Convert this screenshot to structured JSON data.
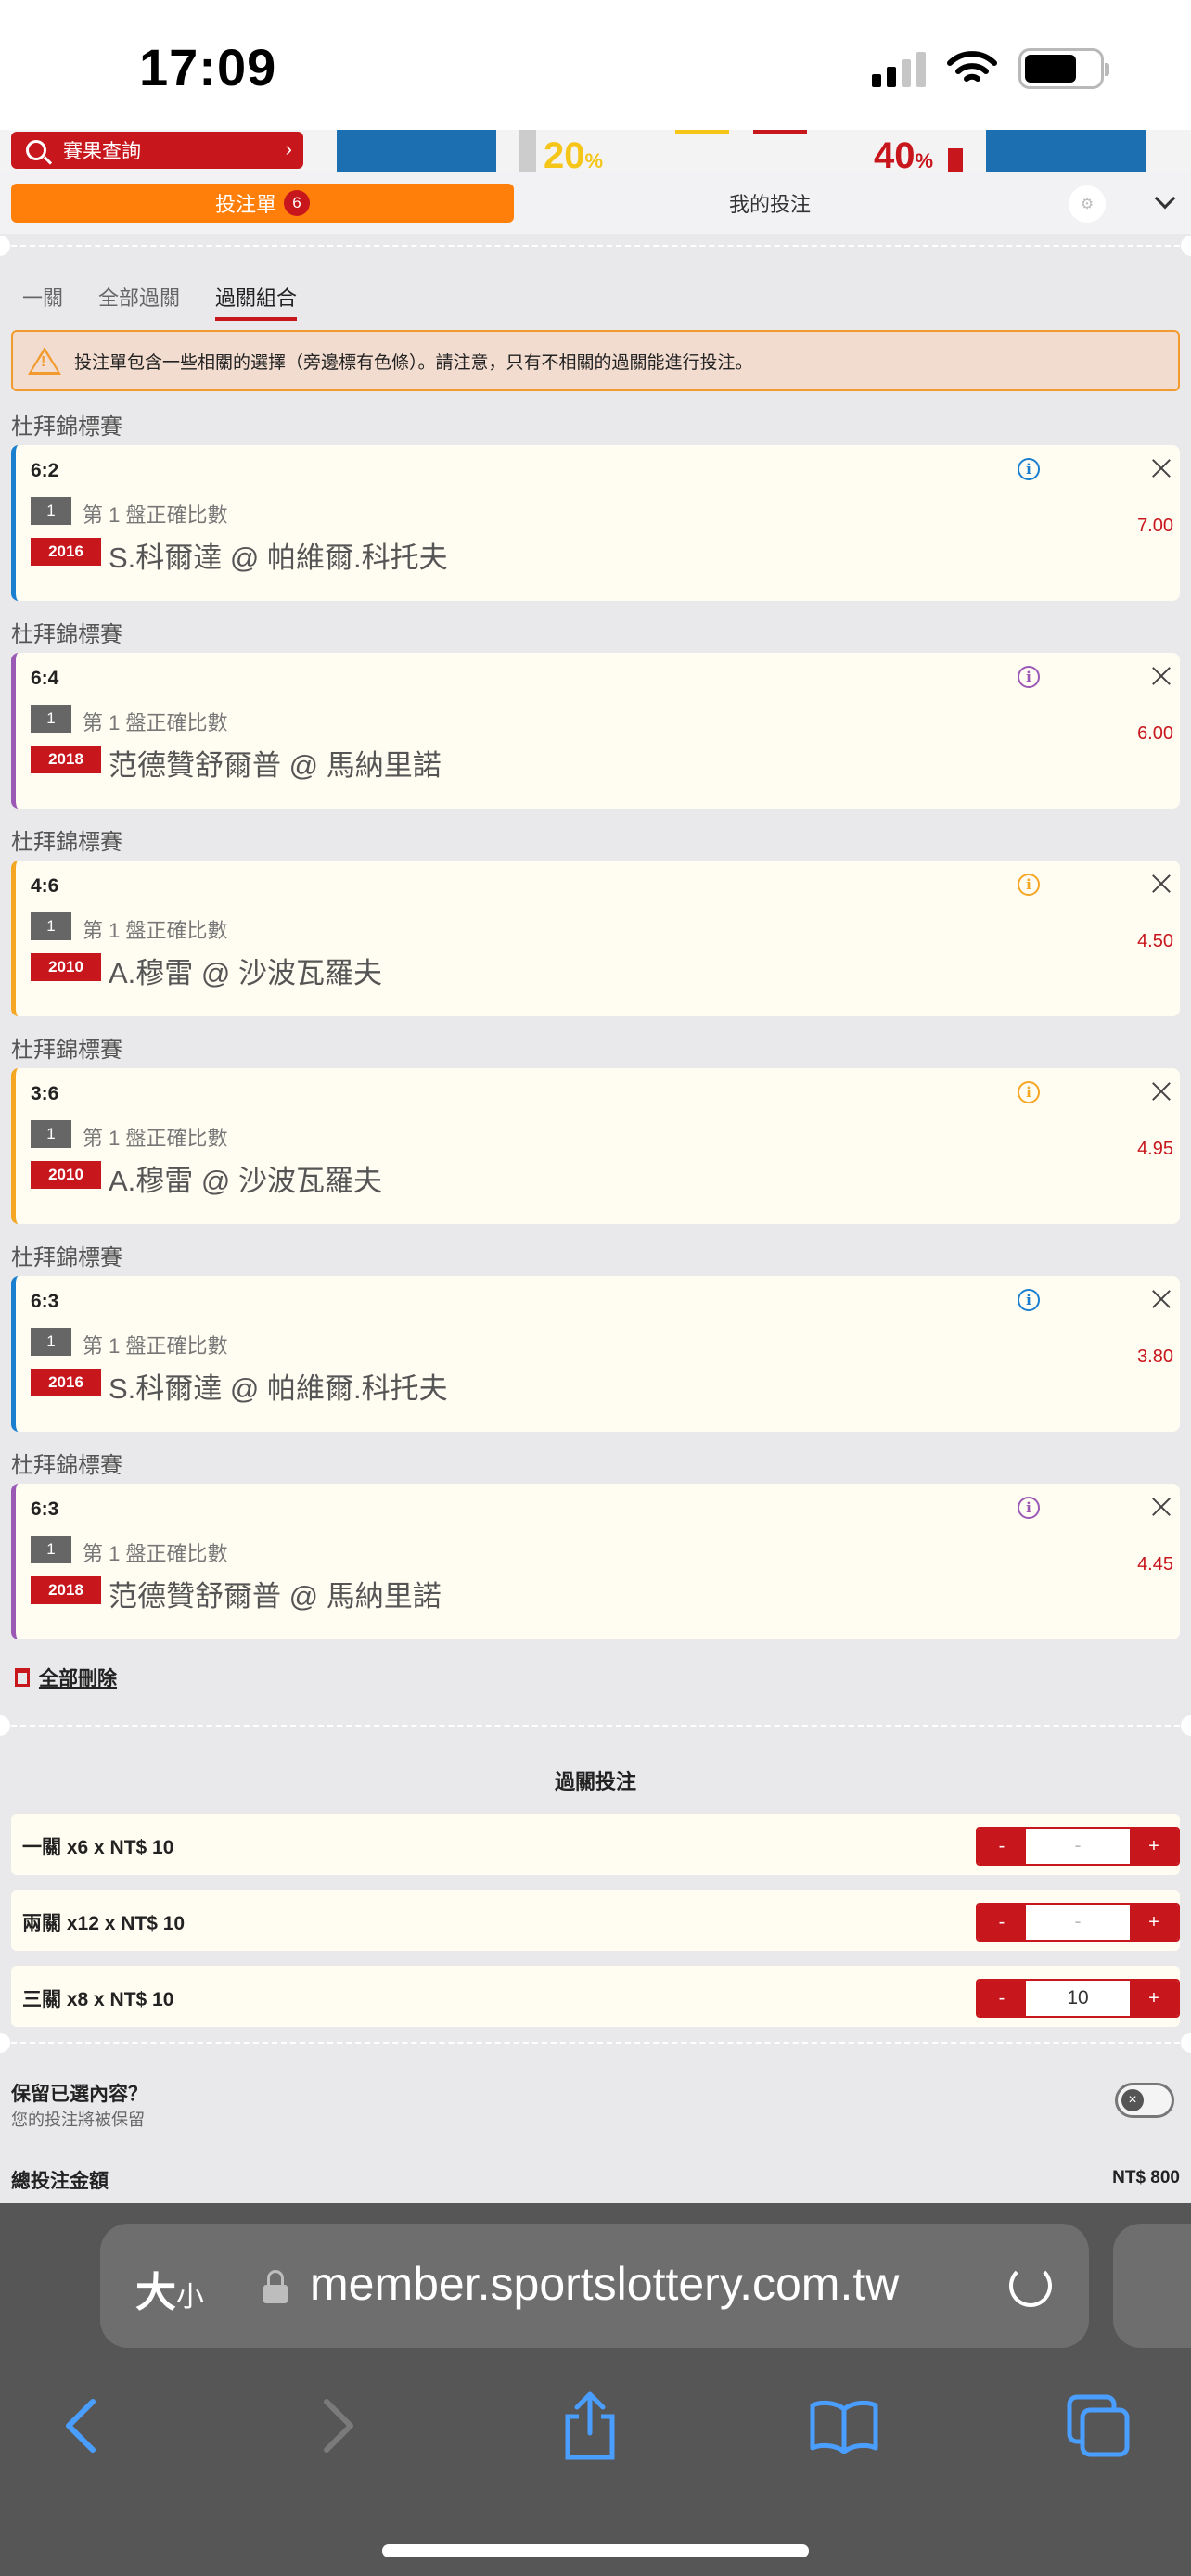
{
  "status_bar": {
    "time": "17:09"
  },
  "background": {
    "result_query_label": "賽果查詢",
    "pct_left": "20",
    "pct_right": "40",
    "pct_unit": "%"
  },
  "tabs": {
    "bet_slip_label": "投注單",
    "bet_slip_count": "6",
    "my_bets_label": "我的投注"
  },
  "subtabs": {
    "single": "一關",
    "all_parlay": "全部過關",
    "parlay_combo": "過關組合"
  },
  "warning_text": "投注單包含一些相關的選擇（旁邊標有色條）。請注意，只有不相關的過關能進行投注。",
  "accent_colors": {
    "red": "#c8161d",
    "orange": "#ff7f0a",
    "blue": "#1b7fcf",
    "purple": "#9b59b6",
    "amber": "#f5a623"
  },
  "selections": [
    {
      "league": "杜拜錦標賽",
      "score": "6:2",
      "set": "1",
      "market": "第 1 盤正確比數",
      "event_id": "2016",
      "teams": "S.科爾達 @ 帕維爾.科托夫",
      "odds": "7.00",
      "color": "#1b7fcf"
    },
    {
      "league": "杜拜錦標賽",
      "score": "6:4",
      "set": "1",
      "market": "第 1 盤正確比數",
      "event_id": "2018",
      "teams": "范德贊舒爾普 @ 馬納里諾",
      "odds": "6.00",
      "color": "#9b59b6"
    },
    {
      "league": "杜拜錦標賽",
      "score": "4:6",
      "set": "1",
      "market": "第 1 盤正確比數",
      "event_id": "2010",
      "teams": "A.穆雷 @ 沙波瓦羅夫",
      "odds": "4.50",
      "color": "#f5a623"
    },
    {
      "league": "杜拜錦標賽",
      "score": "3:6",
      "set": "1",
      "market": "第 1 盤正確比數",
      "event_id": "2010",
      "teams": "A.穆雷 @ 沙波瓦羅夫",
      "odds": "4.95",
      "color": "#f5a623"
    },
    {
      "league": "杜拜錦標賽",
      "score": "6:3",
      "set": "1",
      "market": "第 1 盤正確比數",
      "event_id": "2016",
      "teams": "S.科爾達 @ 帕維爾.科托夫",
      "odds": "3.80",
      "color": "#1b7fcf"
    },
    {
      "league": "杜拜錦標賽",
      "score": "6:3",
      "set": "1",
      "market": "第 1 盤正確比數",
      "event_id": "2018",
      "teams": "范德贊舒爾普 @ 馬納里諾",
      "odds": "4.45",
      "color": "#9b59b6"
    }
  ],
  "delete_all_label": "全部刪除",
  "parlay": {
    "title": "過關投注",
    "rows": [
      {
        "label": "一關 x6 x NT$ 10",
        "value": "-"
      },
      {
        "label": "兩關 x12 x NT$ 10",
        "value": "-"
      },
      {
        "label": "三關 x8 x NT$ 10",
        "value": "10"
      }
    ],
    "minus": "-",
    "plus": "+"
  },
  "keep": {
    "title": "保留已選內容？",
    "subtitle": "您的投注將被保留"
  },
  "total": {
    "label": "總投注金額",
    "value": "NT$ 800"
  },
  "browser": {
    "text_size_label": "大",
    "text_size_small": "小",
    "url": "member.sportslottery.com.tw"
  }
}
